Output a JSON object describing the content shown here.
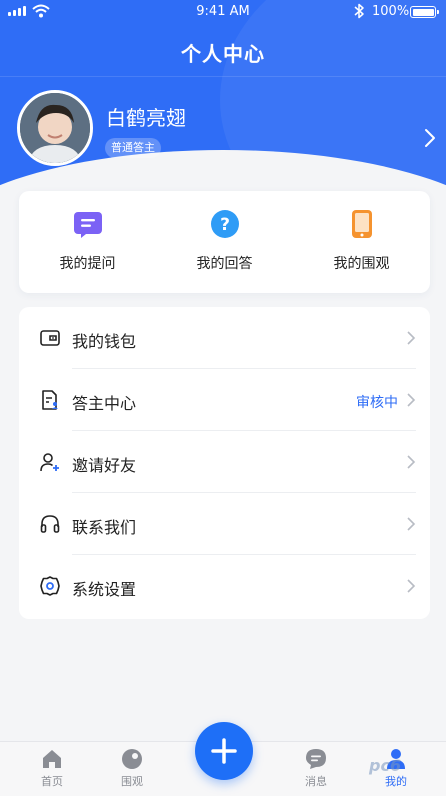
{
  "status_bar": {
    "time": "9:41 AM",
    "battery": "100%"
  },
  "header": {
    "title": "个人中心"
  },
  "profile": {
    "name": "白鹤亮翅",
    "role": "普通答主"
  },
  "quick_actions": [
    {
      "label": "我的提问",
      "icon": "question-chat-icon",
      "color": "#7b62f5"
    },
    {
      "label": "我的回答",
      "icon": "answer-question-icon",
      "color": "#2f9cf6"
    },
    {
      "label": "我的围观",
      "icon": "phone-watch-icon",
      "color": "#f5932f"
    }
  ],
  "menu": [
    {
      "label": "我的钱包",
      "icon": "wallet-icon",
      "status": ""
    },
    {
      "label": "答主中心",
      "icon": "document-user-icon",
      "status": "审核中"
    },
    {
      "label": "邀请好友",
      "icon": "add-user-icon",
      "status": ""
    },
    {
      "label": "联系我们",
      "icon": "headset-icon",
      "status": ""
    },
    {
      "label": "系统设置",
      "icon": "settings-gear-icon",
      "status": ""
    }
  ],
  "tabbar": [
    {
      "label": "首页",
      "icon": "home-icon"
    },
    {
      "label": "围观",
      "icon": "watch-icon"
    },
    {
      "label": "消息",
      "icon": "message-icon"
    },
    {
      "label": "我的",
      "icon": "user-icon",
      "active": true
    }
  ],
  "fab": {
    "icon": "plus-icon"
  },
  "watermark": "pc6",
  "colors": {
    "primary": "#2f6df6",
    "background": "#f4f5f7"
  }
}
